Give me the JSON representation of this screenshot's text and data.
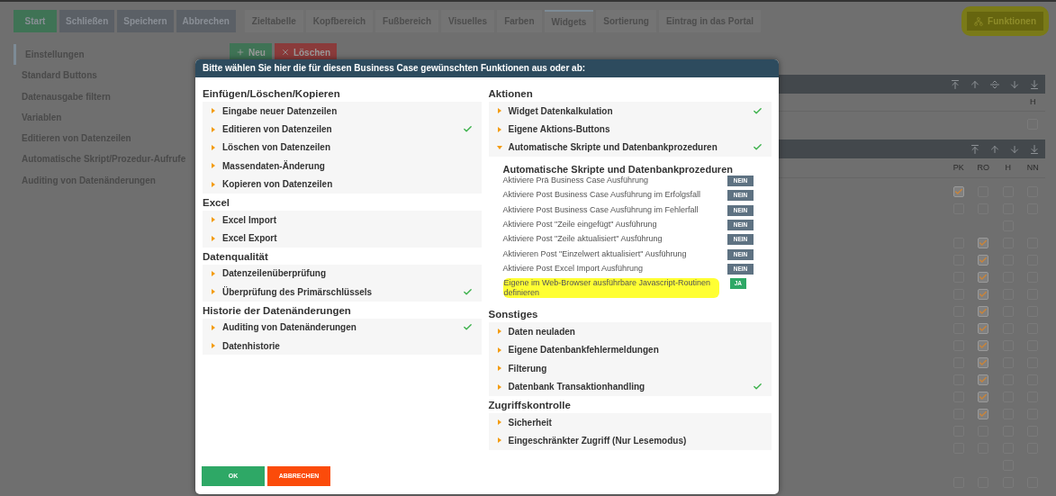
{
  "toolbar": {
    "buttons": [
      {
        "label": "Start",
        "kind": "primary"
      },
      {
        "label": "Schließen",
        "kind": "secondary"
      },
      {
        "label": "Speichern",
        "kind": "secondary"
      },
      {
        "label": "Abbrechen",
        "kind": "secondary"
      }
    ]
  },
  "tabs": [
    {
      "label": "Zieltabelle",
      "selected": false
    },
    {
      "label": "Kopfbereich",
      "selected": false
    },
    {
      "label": "Fußbereich",
      "selected": false
    },
    {
      "label": "Visuelles",
      "selected": false
    },
    {
      "label": "Farben",
      "selected": false
    },
    {
      "label": "Widgets",
      "selected": true
    },
    {
      "label": "Sortierung",
      "selected": false
    },
    {
      "label": "Eintrag in das Portal",
      "selected": false
    }
  ],
  "functions_button": {
    "label": "Funktionen",
    "highlighted": true
  },
  "sidebar": {
    "items": [
      {
        "label": "Einstellungen",
        "selected": true
      },
      {
        "label": "Standard Buttons",
        "selected": false
      },
      {
        "label": "Datenausgabe filtern",
        "selected": false
      },
      {
        "label": "Variablen",
        "selected": false
      },
      {
        "label": "Editieren von Datenzeilen",
        "selected": false
      },
      {
        "label": "Automatische Skript/Prozedur-Aufrufe",
        "selected": false
      },
      {
        "label": "Auditing von Datenänderungen",
        "selected": false
      }
    ]
  },
  "actions": [
    {
      "label": "Neu",
      "kind": "add"
    },
    {
      "label": "Löschen",
      "kind": "delete"
    }
  ],
  "panel_1": {
    "columns": [
      "H"
    ],
    "rows": [
      {
        "cells": [
          {
            "kind": "checkbox",
            "checked": false
          }
        ]
      }
    ]
  },
  "panel_2": {
    "columns": [
      "PK",
      "RO",
      "H",
      "NN"
    ],
    "rows": [
      {
        "cells": [
          {
            "kind": "checkbox",
            "checked": true
          },
          {
            "kind": "checkbox",
            "checked": false
          },
          {
            "kind": "checkbox",
            "checked": false
          },
          {
            "kind": "checkbox",
            "checked": false
          }
        ]
      },
      {
        "cells": [
          {
            "kind": "checkbox",
            "checked": false
          },
          {
            "kind": "checkbox",
            "checked": false
          },
          {
            "kind": "checkbox",
            "checked": false
          },
          {
            "kind": "checkbox",
            "checked": false
          }
        ]
      },
      {
        "cells": [
          {
            "kind": "blank"
          },
          {
            "kind": "blank"
          },
          {
            "kind": "checkbox",
            "checked": false
          },
          {
            "kind": "blank"
          }
        ]
      },
      {
        "cells": [
          {
            "kind": "checkbox",
            "checked": false
          },
          {
            "kind": "checkbox",
            "checked": true
          },
          {
            "kind": "checkbox",
            "checked": false
          },
          {
            "kind": "checkbox",
            "checked": false
          }
        ]
      },
      {
        "cells": [
          {
            "kind": "checkbox",
            "checked": false
          },
          {
            "kind": "checkbox",
            "checked": true
          },
          {
            "kind": "checkbox",
            "checked": false
          },
          {
            "kind": "checkbox",
            "checked": false
          }
        ]
      },
      {
        "cells": [
          {
            "kind": "checkbox",
            "checked": false
          },
          {
            "kind": "checkbox",
            "checked": true
          },
          {
            "kind": "checkbox",
            "checked": false
          },
          {
            "kind": "checkbox",
            "checked": false
          }
        ]
      },
      {
        "cells": [
          {
            "kind": "checkbox",
            "checked": false
          },
          {
            "kind": "checkbox",
            "checked": true
          },
          {
            "kind": "checkbox",
            "checked": false
          },
          {
            "kind": "checkbox",
            "checked": false
          }
        ]
      },
      {
        "cells": [
          {
            "kind": "checkbox",
            "checked": false
          },
          {
            "kind": "checkbox",
            "checked": true
          },
          {
            "kind": "checkbox",
            "checked": false
          },
          {
            "kind": "checkbox",
            "checked": false
          }
        ]
      },
      {
        "cells": [
          {
            "kind": "checkbox",
            "checked": false
          },
          {
            "kind": "checkbox",
            "checked": true
          },
          {
            "kind": "checkbox",
            "checked": false
          },
          {
            "kind": "checkbox",
            "checked": false
          }
        ]
      },
      {
        "cells": [
          {
            "kind": "checkbox",
            "checked": false
          },
          {
            "kind": "checkbox",
            "checked": true
          },
          {
            "kind": "checkbox",
            "checked": false
          },
          {
            "kind": "checkbox",
            "checked": false
          }
        ]
      },
      {
        "cells": [
          {
            "kind": "checkbox",
            "checked": false
          },
          {
            "kind": "checkbox",
            "checked": true
          },
          {
            "kind": "checkbox",
            "checked": false
          },
          {
            "kind": "checkbox",
            "checked": false
          }
        ]
      },
      {
        "cells": [
          {
            "kind": "checkbox",
            "checked": false
          },
          {
            "kind": "checkbox",
            "checked": true
          },
          {
            "kind": "checkbox",
            "checked": false
          },
          {
            "kind": "checkbox",
            "checked": false
          }
        ]
      },
      {
        "cells": [
          {
            "kind": "checkbox",
            "checked": false
          },
          {
            "kind": "checkbox",
            "checked": true
          },
          {
            "kind": "checkbox",
            "checked": false
          },
          {
            "kind": "checkbox",
            "checked": false
          }
        ]
      },
      {
        "cells": [
          {
            "kind": "checkbox",
            "checked": false
          },
          {
            "kind": "checkbox",
            "checked": true
          },
          {
            "kind": "checkbox",
            "checked": false
          },
          {
            "kind": "checkbox",
            "checked": false
          }
        ]
      },
      {
        "cells": [
          {
            "kind": "checkbox",
            "checked": false
          },
          {
            "kind": "checkbox",
            "checked": false
          },
          {
            "kind": "checkbox",
            "checked": false
          },
          {
            "kind": "checkbox",
            "checked": false
          }
        ]
      },
      {
        "cells": [
          {
            "kind": "checkbox",
            "checked": false
          },
          {
            "kind": "checkbox",
            "checked": false
          },
          {
            "kind": "checkbox",
            "checked": false
          },
          {
            "kind": "checkbox",
            "checked": false
          }
        ]
      },
      {
        "cells": [
          {
            "kind": "blank"
          },
          {
            "kind": "blank"
          },
          {
            "kind": "checkbox",
            "checked": false
          },
          {
            "kind": "blank"
          }
        ]
      },
      {
        "cells": [
          {
            "kind": "checkbox",
            "checked": false
          },
          {
            "kind": "checkbox",
            "checked": false
          },
          {
            "kind": "checkbox",
            "checked": false
          },
          {
            "kind": "checkbox",
            "checked": false
          }
        ]
      }
    ]
  },
  "dialog": {
    "title": "Bitte wählen Sie hier die für diesen Business Case gewünschten Funktionen aus oder ab:",
    "left": [
      {
        "title": "Einfügen/Löschen/Kopieren",
        "items": [
          {
            "label": "Eingabe neuer Datenzeilen",
            "checked": false,
            "expanded": false
          },
          {
            "label": "Editieren von Datenzeilen",
            "checked": true,
            "expanded": false
          },
          {
            "label": "Löschen von Datenzeilen",
            "checked": false,
            "expanded": false
          },
          {
            "label": "Massendaten-Änderung",
            "checked": false,
            "expanded": false
          },
          {
            "label": "Kopieren von Datenzeilen",
            "checked": false,
            "expanded": false
          }
        ]
      },
      {
        "title": "Excel",
        "items": [
          {
            "label": "Excel Import",
            "checked": false,
            "expanded": false
          },
          {
            "label": "Excel Export",
            "checked": false,
            "expanded": false
          }
        ]
      },
      {
        "title": "Datenqualität",
        "items": [
          {
            "label": "Datenzeilenüberprüfung",
            "checked": false,
            "expanded": false
          },
          {
            "label": "Überprüfung des Primärschlüssels",
            "checked": true,
            "expanded": false
          }
        ]
      },
      {
        "title": "Historie der Datenänderungen",
        "items": [
          {
            "label": "Auditing von Datenänderungen",
            "checked": true,
            "expanded": false
          },
          {
            "label": "Datenhistorie",
            "checked": false,
            "expanded": false
          }
        ]
      }
    ],
    "right": [
      {
        "title": "Aktionen",
        "items": [
          {
            "label": "Widget Datenkalkulation",
            "checked": true,
            "expanded": false
          },
          {
            "label": "Eigene Aktions-Buttons",
            "checked": false,
            "expanded": false
          },
          {
            "label": "Automatische Skripte und Datenbankprozeduren",
            "checked": true,
            "expanded": true,
            "detail": {
              "title": "Automatische Skripte und Datenbankprozeduren",
              "options": [
                {
                  "label": "Aktiviere Prä Business Case Ausführung",
                  "toggle": "NEIN",
                  "on": false,
                  "highlighted": false
                },
                {
                  "label": "Aktiviere Post Business Case Ausführung im Erfolgsfall",
                  "toggle": "NEIN",
                  "on": false,
                  "highlighted": false
                },
                {
                  "label": "Aktiviere Post Business Case Ausführung im Fehlerfall",
                  "toggle": "NEIN",
                  "on": false,
                  "highlighted": false
                },
                {
                  "label": "Aktiviere Post \"Zeile eingefügt\" Ausführung",
                  "toggle": "NEIN",
                  "on": false,
                  "highlighted": false
                },
                {
                  "label": "Aktiviere Post \"Zeile aktualisiert\" Ausführung",
                  "toggle": "NEIN",
                  "on": false,
                  "highlighted": false
                },
                {
                  "label": "Aktivieren Post \"Einzelwert aktualisiert\" Ausführung",
                  "toggle": "NEIN",
                  "on": false,
                  "highlighted": false
                },
                {
                  "label": "Aktiviere Post Excel Import Ausführung",
                  "toggle": "NEIN",
                  "on": false,
                  "highlighted": false
                },
                {
                  "label": "Eigene im Web-Browser ausführbare Javascript-Routinen definieren",
                  "toggle": "JA",
                  "on": true,
                  "highlighted": true
                }
              ]
            }
          }
        ]
      },
      {
        "title": "Sonstiges",
        "items": [
          {
            "label": "Daten neuladen",
            "checked": false,
            "expanded": false
          },
          {
            "label": "Eigene Datenbankfehlermeldungen",
            "checked": false,
            "expanded": false
          },
          {
            "label": "Filterung",
            "checked": false,
            "expanded": false
          },
          {
            "label": "Datenbank Transaktionhandling",
            "checked": true,
            "expanded": false
          }
        ]
      },
      {
        "title": "Zugriffskontrolle",
        "items": [
          {
            "label": "Sicherheit",
            "checked": false,
            "expanded": false
          },
          {
            "label": "Eingeschränkter Zugriff (Nur Lesemodus)",
            "checked": false,
            "expanded": false
          }
        ]
      }
    ],
    "buttons": [
      {
        "label": "OK",
        "kind": "confirm"
      },
      {
        "label": "ABBRECHEN",
        "kind": "cancel"
      }
    ]
  }
}
